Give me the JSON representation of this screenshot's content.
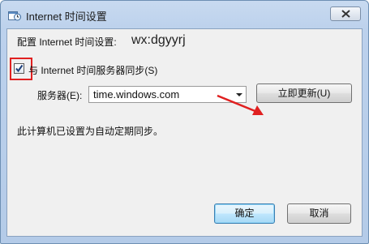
{
  "window": {
    "title": "Internet 时间设置",
    "close_symbol": "✕"
  },
  "icons": {
    "title": "calendar-clock-icon",
    "close": "close-icon",
    "check": "checkmark-icon",
    "arrow": "red-arrow-annotation"
  },
  "colors": {
    "annotation": "#e02020",
    "title_bg": "#bcd1ec"
  },
  "config_label": "配置 Internet 时间设置:",
  "watermark": "wx:dgyyrj",
  "sync": {
    "label": "与 Internet 时间服务器同步(S)",
    "checked": true
  },
  "server": {
    "label": "服务器(E):",
    "value": "time.windows.com",
    "update_button": "立即更新(U)"
  },
  "status": "此计算机已设置为自动定期同步。",
  "buttons": {
    "ok": "确定",
    "cancel": "取消"
  }
}
